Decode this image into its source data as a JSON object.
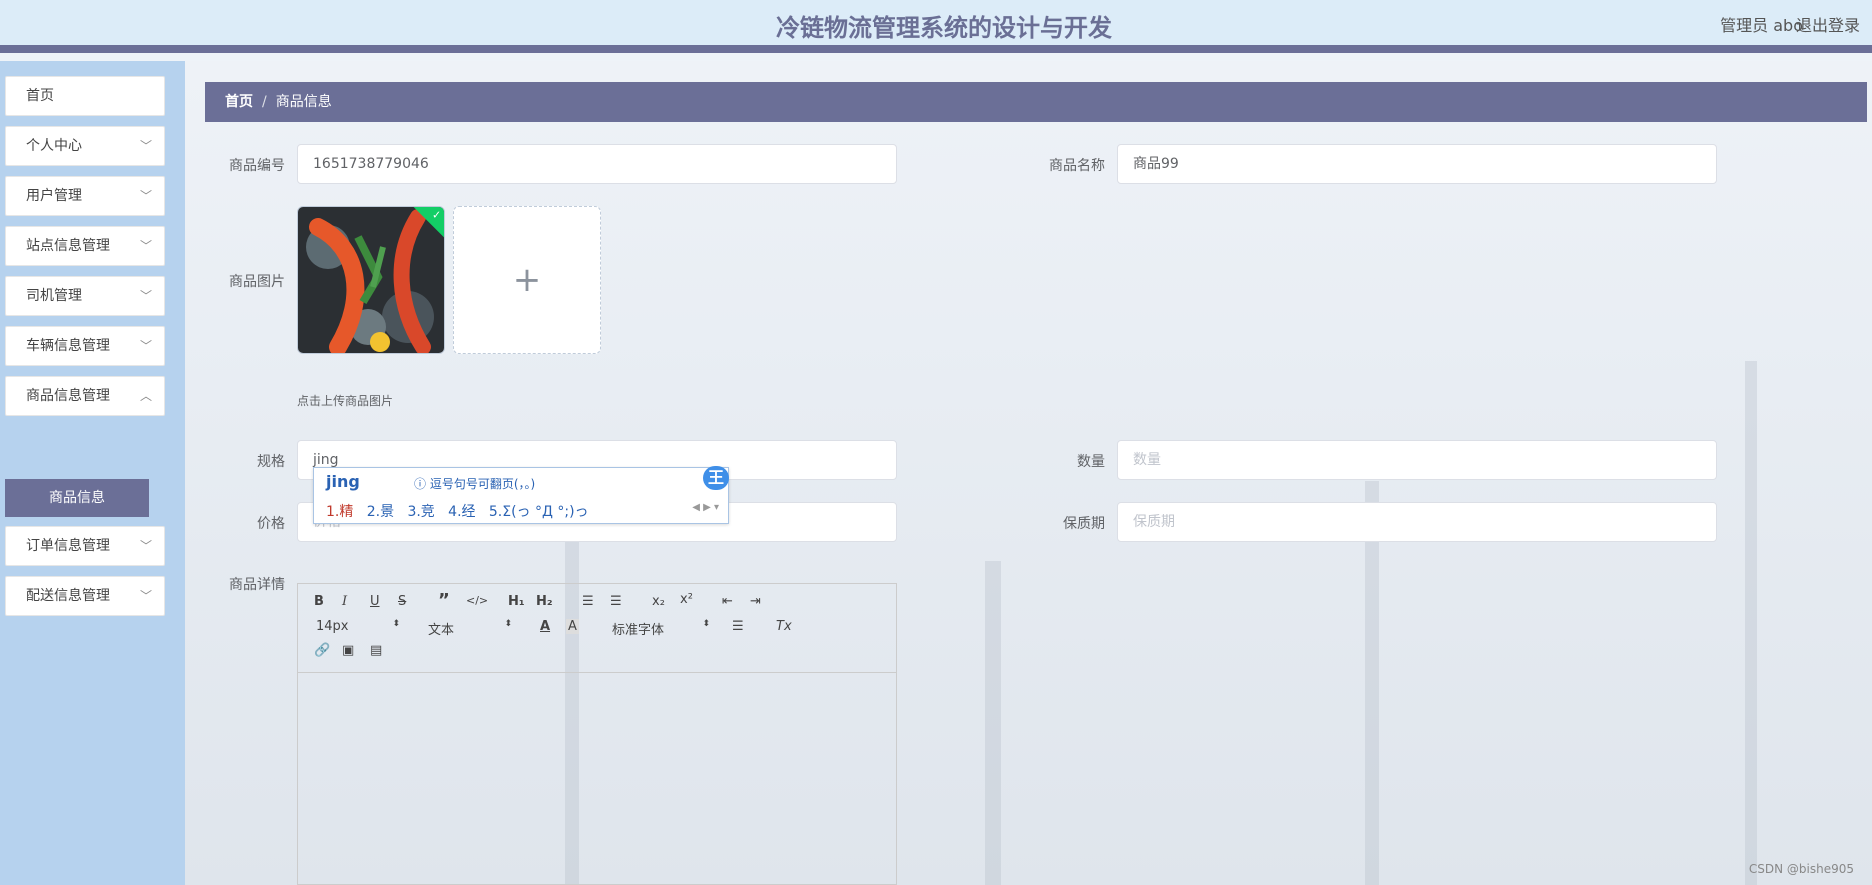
{
  "header": {
    "title": "冷链物流管理系统的设计与开发",
    "user": "管理员 abo",
    "logout": "退出登录"
  },
  "sidebar": {
    "items": [
      {
        "label": "首页"
      },
      {
        "label": "个人中心"
      },
      {
        "label": "用户管理"
      },
      {
        "label": "站点信息管理"
      },
      {
        "label": "司机管理"
      },
      {
        "label": "车辆信息管理"
      },
      {
        "label": "商品信息管理"
      },
      {
        "label": "订单信息管理"
      },
      {
        "label": "配送信息管理"
      }
    ],
    "sub_item": "商品信息"
  },
  "breadcrumb": {
    "home": "首页",
    "sep": "/",
    "current": "商品信息"
  },
  "form": {
    "code_label": "商品编号",
    "code_value": "1651738779046",
    "name_label": "商品名称",
    "name_value": "商品99",
    "image_label": "商品图片",
    "image_tip": "点击上传商品图片",
    "upload_plus": "+",
    "spec_label": "规格",
    "spec_value": "jing",
    "qty_label": "数量",
    "qty_placeholder": "数量",
    "price_label": "价格",
    "price_placeholder": "价格",
    "shelf_label": "保质期",
    "shelf_placeholder": "保质期",
    "detail_label": "商品详情"
  },
  "ime": {
    "composition": "jing",
    "hint": "ⓘ 逗号句号可翻页(，。)",
    "logo": "王",
    "candidates": [
      "1.精",
      "2.景",
      "3.竞",
      "4.经",
      "5.Σ(っ °Д °;)っ"
    ]
  },
  "editor": {
    "size": "14px",
    "format": "文本",
    "font": "标准字体"
  },
  "footer": {
    "watermark": "CSDN @bishe905"
  },
  "colors": {
    "accent": "#6b6f97",
    "sidebar_bg": "#b6d2ee",
    "header_bg": "#dcecf8",
    "success": "#13ce66"
  }
}
